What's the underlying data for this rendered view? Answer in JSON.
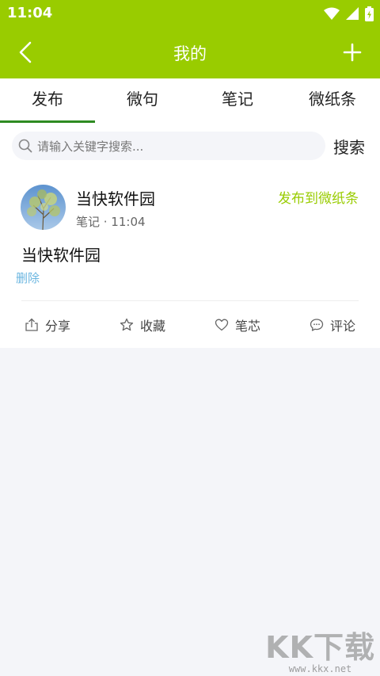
{
  "status_bar": {
    "time": "11:04"
  },
  "header": {
    "title": "我的"
  },
  "tabs": [
    {
      "label": "发布",
      "active": true
    },
    {
      "label": "微句",
      "active": false
    },
    {
      "label": "笔记",
      "active": false
    },
    {
      "label": "微纸条",
      "active": false
    }
  ],
  "search": {
    "placeholder": "请输入关键字搜索...",
    "value": "",
    "button_label": "搜索"
  },
  "post": {
    "author": "当快软件园",
    "meta": "笔记 · 11:04",
    "publish_label": "发布到微纸条",
    "content": "当快软件园",
    "delete_label": "删除",
    "actions": [
      {
        "label": "分享",
        "icon": "share-icon"
      },
      {
        "label": "收藏",
        "icon": "star-icon"
      },
      {
        "label": "笔芯",
        "icon": "heart-icon"
      },
      {
        "label": "评论",
        "icon": "comment-icon"
      }
    ]
  },
  "watermark": {
    "logo": "KK下载",
    "url": "www.kkx.net"
  },
  "colors": {
    "accent": "#99cc00",
    "tab_indicator": "#2e8b22",
    "link": "#6bb6e0",
    "background": "#f4f5f9"
  }
}
